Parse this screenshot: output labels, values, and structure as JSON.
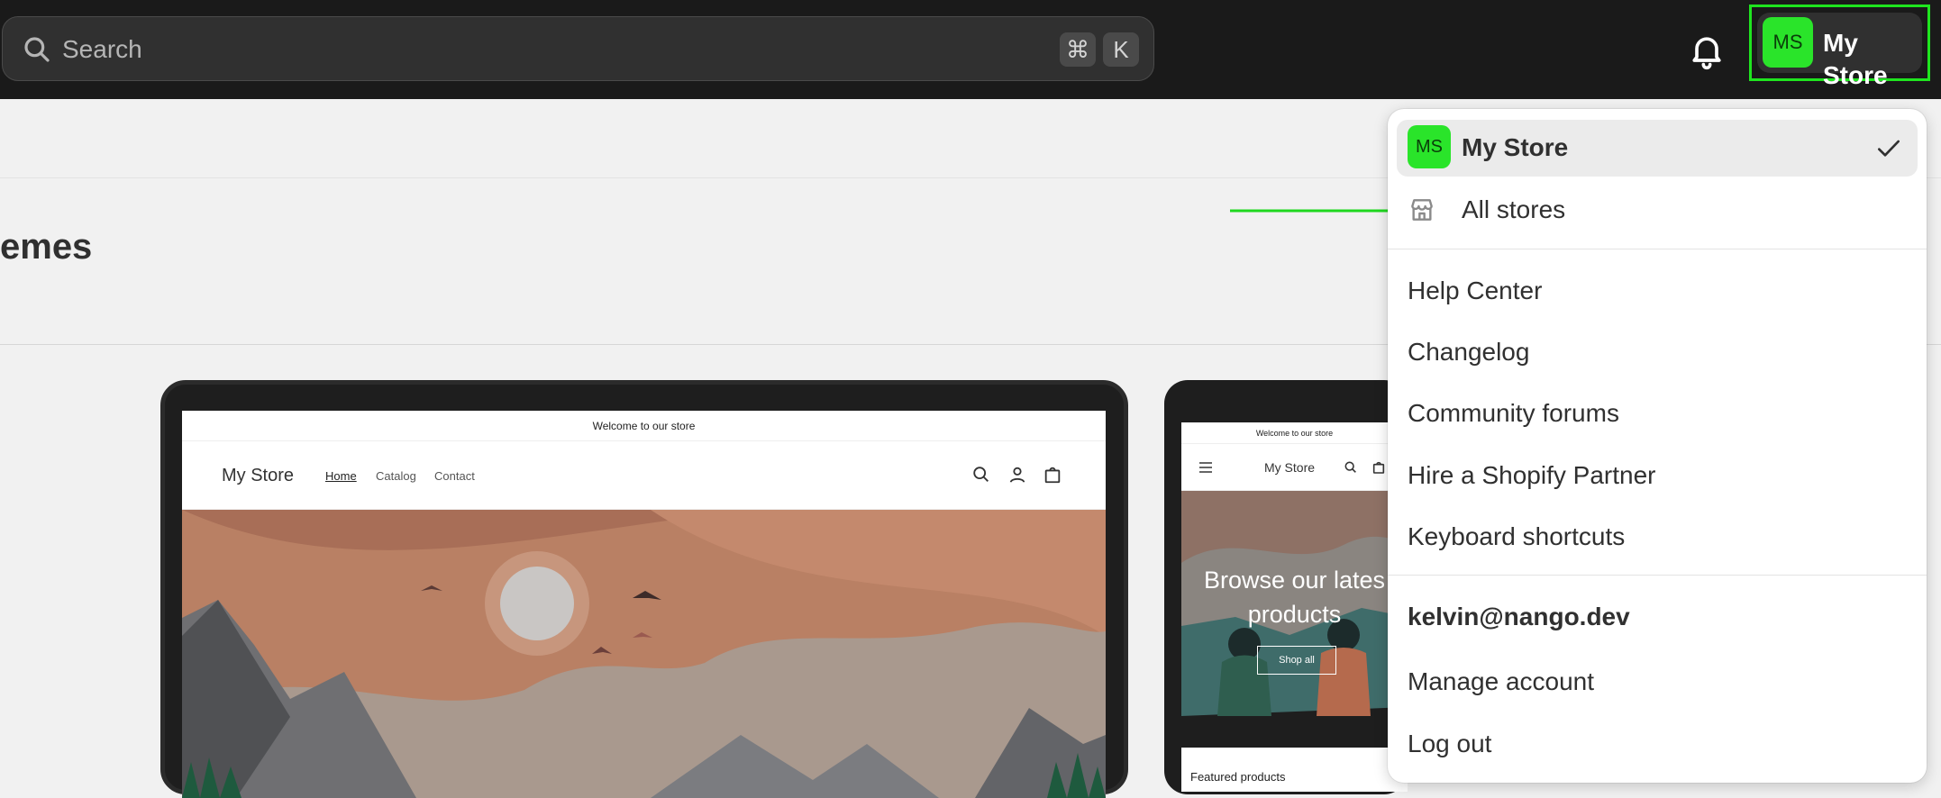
{
  "topbar": {
    "search_placeholder": "Search",
    "shortcut_keys": [
      "⌘",
      "K"
    ],
    "store_initials": "MS",
    "store_name": "My Store"
  },
  "page": {
    "heading_visible": "emes"
  },
  "preview": {
    "desktop": {
      "announcement": "Welcome to our store",
      "logo": "My Store",
      "nav": [
        "Home",
        "Catalog",
        "Contact"
      ]
    },
    "mobile": {
      "announcement": "Welcome to our store",
      "logo": "My Store",
      "hero_title_line1": "Browse our lates",
      "hero_title_line2": "products",
      "hero_button": "Shop all",
      "section_title": "Featured products"
    }
  },
  "menu": {
    "current_store": {
      "initials": "MS",
      "name": "My Store"
    },
    "all_stores": "All stores",
    "items": [
      "Help Center",
      "Changelog",
      "Community forums",
      "Hire a Shopify Partner",
      "Keyboard shortcuts"
    ],
    "account_email": "kelvin@nango.dev",
    "account_items": [
      "Manage account",
      "Log out"
    ]
  },
  "colors": {
    "topbar_bg": "#1a1a1a",
    "avatar_green": "#2ae42a",
    "highlight_outline": "#1fe51f",
    "annotation_arrow": "#1fd81f"
  },
  "icons": [
    "search-icon",
    "command-key-icon",
    "bell-icon",
    "store-icon",
    "checkmark-icon",
    "arrow-annotation"
  ]
}
